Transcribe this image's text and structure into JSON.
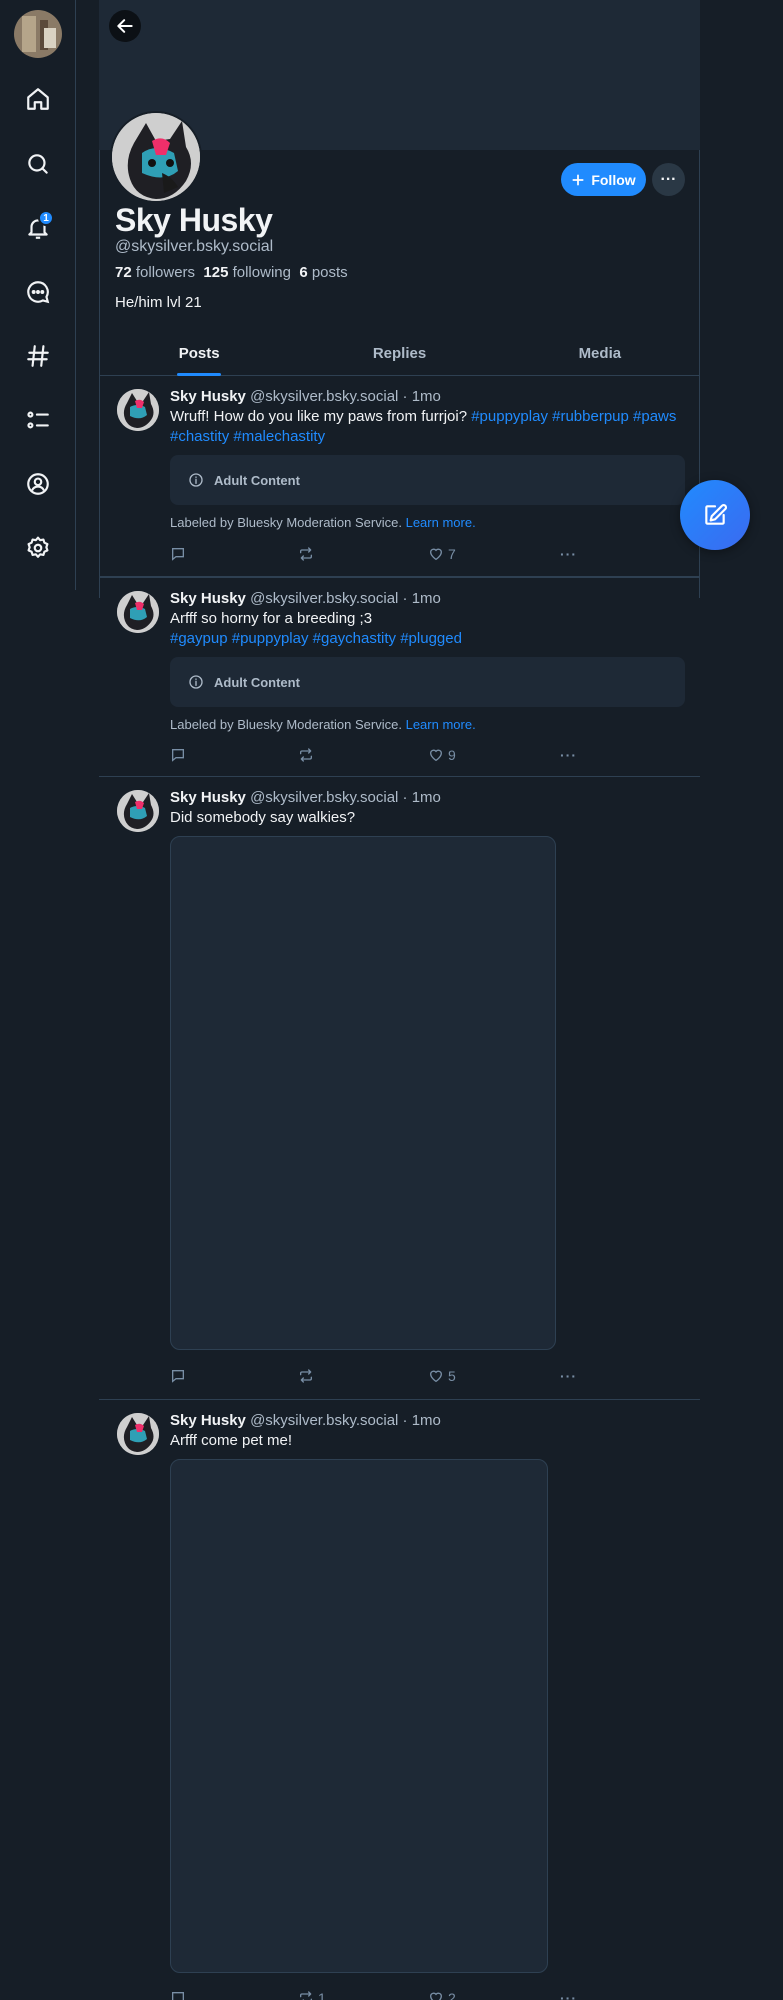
{
  "nav": {
    "notification_count": "1"
  },
  "profile": {
    "display_name": "Sky Husky",
    "handle": "@skysilver.bsky.social",
    "followers_count": "72",
    "followers_label": "followers",
    "following_count": "125",
    "following_label": "following",
    "posts_count": "6",
    "posts_label": "posts",
    "bio": "He/him lvl 21",
    "follow_label": "Follow",
    "more_label": "···"
  },
  "tabs": [
    {
      "label": "Posts",
      "active": true
    },
    {
      "label": "Replies",
      "active": false
    },
    {
      "label": "Media",
      "active": false
    }
  ],
  "posts": [
    {
      "author": "Sky Husky",
      "handle_time": "@skysilver.bsky.social · 1mo",
      "text": "Wruff! How do you like my paws from furrjoi?",
      "tags": [
        "#puppyplay",
        "#rubberpup",
        "#paws",
        "#chastity",
        "#malechastity"
      ],
      "warning": "Adult Content",
      "label_note": "Labeled by Bluesky Moderation Service.",
      "learn_more": "Learn more.",
      "likes": "7",
      "reposts": "",
      "replies": ""
    },
    {
      "author": "Sky Husky",
      "handle_time": "@skysilver.bsky.social · 1mo",
      "text": "Arfff so horny for a breeding ;3",
      "tags": [
        "#gaypup",
        "#puppyplay",
        "#gaychastity",
        "#plugged"
      ],
      "warning": "Adult Content",
      "label_note": "Labeled by Bluesky Moderation Service.",
      "learn_more": "Learn more.",
      "likes": "9",
      "reposts": "",
      "replies": ""
    },
    {
      "author": "Sky Husky",
      "handle_time": "@skysilver.bsky.social · 1mo",
      "text": "Did somebody say walkies?",
      "likes": "5",
      "reposts": "",
      "replies": ""
    },
    {
      "author": "Sky Husky",
      "handle_time": "@skysilver.bsky.social · 1mo",
      "text": "Arfff come pet me!",
      "likes": "2",
      "reposts": "1",
      "replies": ""
    }
  ],
  "colors": {
    "background": "#161e27",
    "accent": "#208bfe",
    "border": "#2e4052",
    "muted_text": "#aebbc9"
  }
}
